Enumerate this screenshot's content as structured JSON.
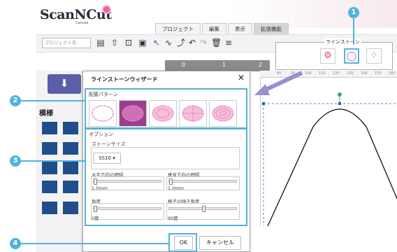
{
  "app": {
    "logo_main": "ScanNCut",
    "logo_sub": "Canvas"
  },
  "tabs": [
    "プロジェクト",
    "編集",
    "表示",
    "拡張機能"
  ],
  "toolbar": {
    "project_name_placeholder": "プロジェクト名"
  },
  "rhinestone_panel": {
    "title": "ラインストーン"
  },
  "ruler": {
    "top_ticks": [
      "0",
      "1",
      "2"
    ],
    "right_ticks": [
      "80",
      "90",
      "100",
      "110",
      "120",
      "130",
      "140",
      "150",
      "160"
    ]
  },
  "left": {
    "pattern_label": "模様"
  },
  "dialog": {
    "title": "ラインストーンウィザード",
    "close": "✕",
    "placement_label": "配置パターン",
    "options_label": "オプション",
    "stone_size_label": "ストーンサイズ",
    "stone_size_value": "SS10",
    "h_spacing_label": "水平方向の間隔",
    "h_spacing_value": "1.0mm",
    "v_spacing_label": "垂直方向の間隔",
    "v_spacing_value": "1.0mm",
    "angle_label": "角度",
    "angle_value": "0度",
    "grid_angle_label": "格子の傾き角度",
    "grid_angle_value": "90度",
    "ok": "OK",
    "cancel": "キャンセル"
  },
  "callouts": [
    "1",
    "2",
    "3",
    "4"
  ],
  "colors": {
    "accent": "#4fb3e0",
    "selected_pattern": "#9c3e8c",
    "stone": "#e060a8",
    "import": "#5a5fa8"
  }
}
